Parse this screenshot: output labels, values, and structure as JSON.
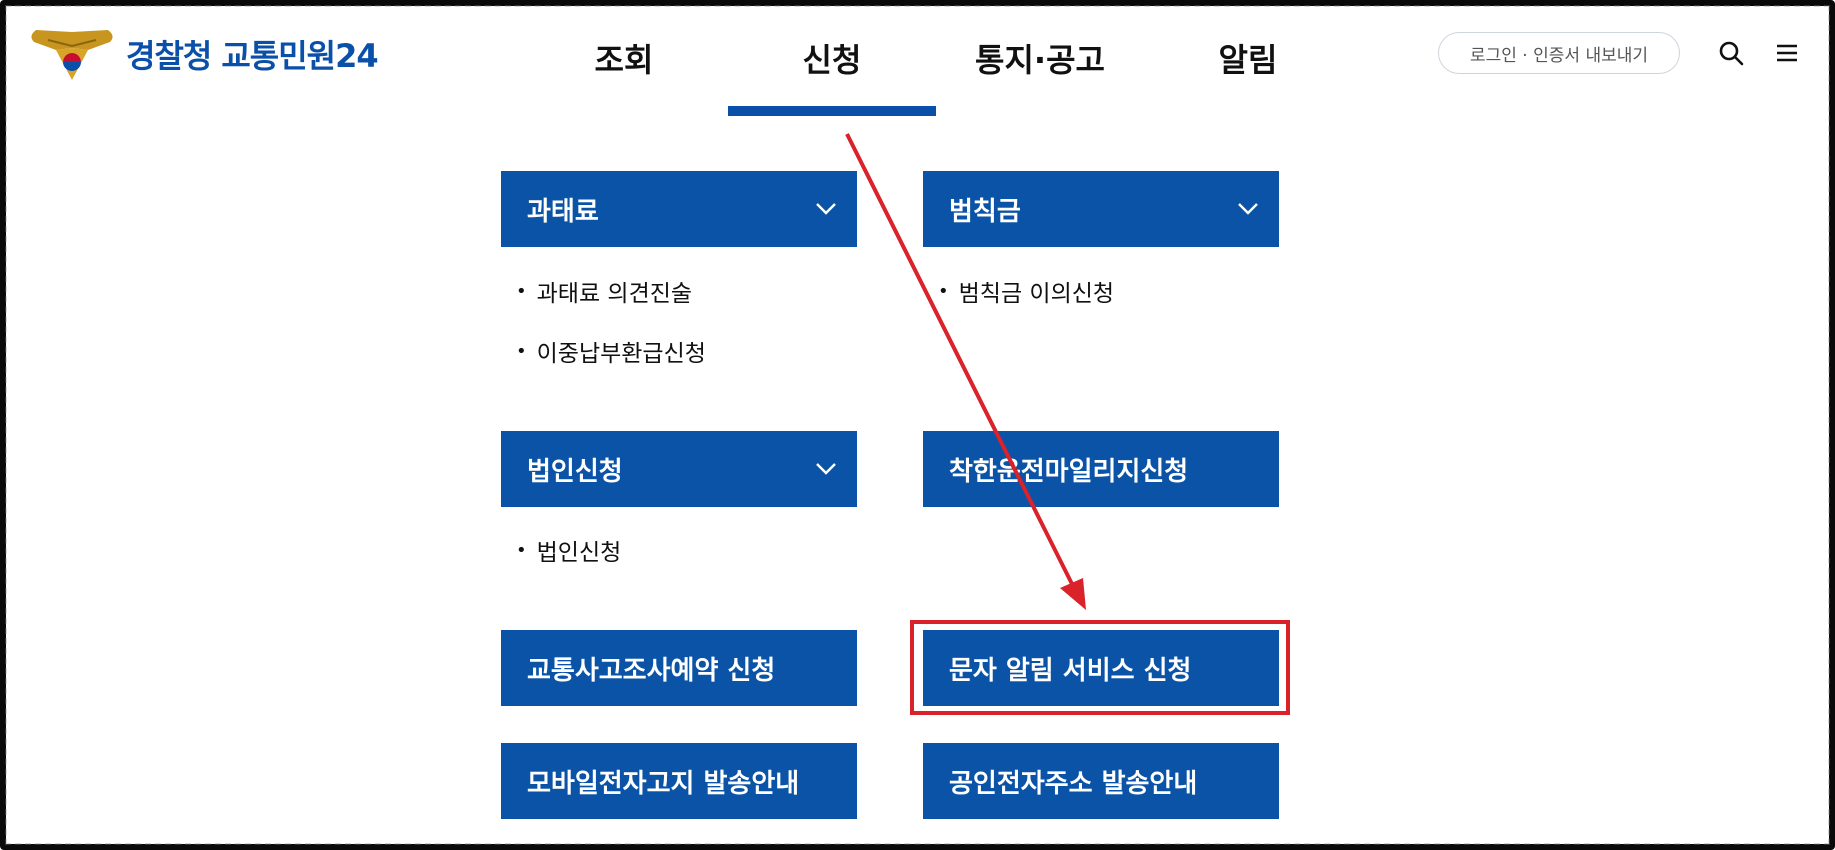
{
  "header": {
    "brand_part1": "경찰청",
    "brand_part2": "교통민원24",
    "nav": [
      {
        "label": "조회"
      },
      {
        "label": "신청"
      },
      {
        "label": "통지·공고"
      },
      {
        "label": "알림"
      }
    ],
    "active_nav": "신청",
    "login_label": "로그인 · 인증서 내보내기",
    "icons": [
      "search-icon",
      "menu-icon"
    ]
  },
  "menu": {
    "fine": {
      "label": "과태료",
      "items": [
        "과태료 의견진술",
        "이중납부환급신청"
      ]
    },
    "penalty": {
      "label": "범칙금",
      "items": [
        "범칙금 이의신청"
      ]
    },
    "corporate": {
      "label": "법인신청",
      "items": [
        "법인신청"
      ]
    },
    "mileage": {
      "label": "착한운전마일리지신청"
    },
    "accident": {
      "label": "교통사고조사예약 신청"
    },
    "sms": {
      "label": "문자 알림 서비스 신청"
    },
    "mobile": {
      "label": "모바일전자고지 발송안내"
    },
    "certified": {
      "label": "공인전자주소 발송안내"
    }
  },
  "annotation_color": "#d9222a",
  "accent_color": "#0a53a6"
}
